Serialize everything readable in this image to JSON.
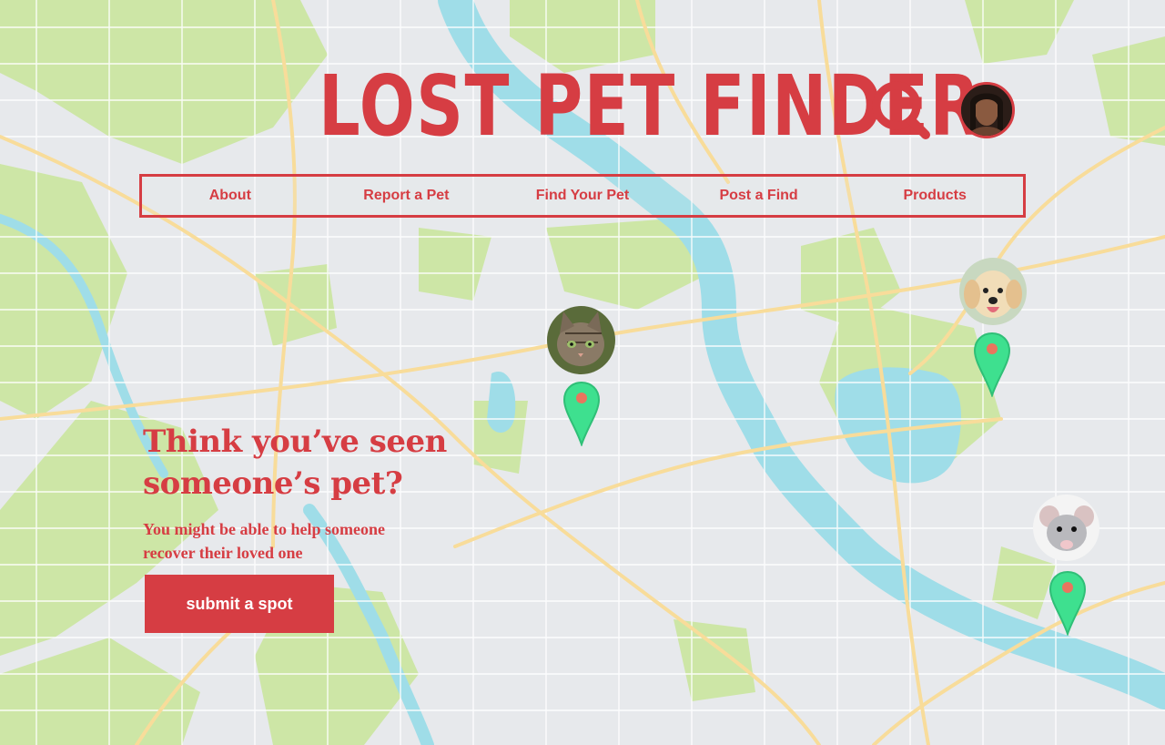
{
  "header": {
    "title": "LOST PET FINDER"
  },
  "icons": {
    "search": "search-icon",
    "avatar": "user-avatar"
  },
  "nav": {
    "items": [
      {
        "label": "About"
      },
      {
        "label": "Report a Pet"
      },
      {
        "label": "Find Your Pet"
      },
      {
        "label": "Post a Find"
      },
      {
        "label": "Products"
      }
    ]
  },
  "hero": {
    "title_line1": "Think you’ve seen",
    "title_line2": "someone’s pet?",
    "subtitle_line1": "You might be able to help someone",
    "subtitle_line2": "recover their loved one",
    "cta_label": "submit a spot"
  },
  "map_markers": [
    {
      "pet": "cat"
    },
    {
      "pet": "dog"
    },
    {
      "pet": "rat"
    }
  ],
  "colors": {
    "accent": "#d63d43",
    "pin": "#3ee08f",
    "water": "#9fdde8",
    "park": "#cde6a6"
  }
}
